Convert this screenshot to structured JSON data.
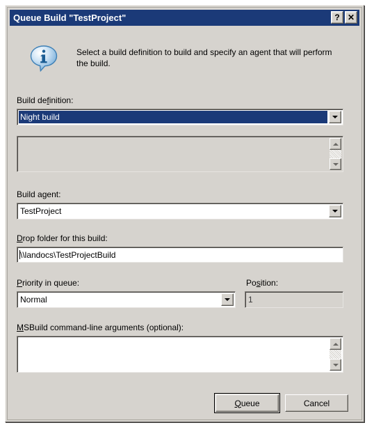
{
  "window": {
    "title": "Queue Build \"TestProject\"",
    "help_button": "?",
    "close_button": "✕",
    "titlebar_color": "#1b3a78",
    "face_color": "#d6d3ce"
  },
  "message": {
    "icon": "info-icon",
    "text": "Select a build definition to build and specify an agent that will perform the build."
  },
  "build_definition": {
    "label_pre": "Build de",
    "label_accel": "f",
    "label_post": "inition:",
    "value": "Night build"
  },
  "definition_details": {
    "value": ""
  },
  "build_agent": {
    "label_pre": "Build a",
    "label_accel": "g",
    "label_post": "ent:",
    "value": "TestProject"
  },
  "drop_folder": {
    "label_accel": "D",
    "label_post": "rop folder for this build:",
    "value": "\\\\landocs\\TestProjectBuild"
  },
  "priority": {
    "label_accel": "P",
    "label_post": "riority in queue:",
    "value": "Normal"
  },
  "position": {
    "label_pre": "Po",
    "label_accel": "s",
    "label_post": "ition:",
    "value": "1"
  },
  "msbuild_args": {
    "label_accel": "M",
    "label_post": "SBuild command-line arguments (optional):",
    "value": ""
  },
  "buttons": {
    "queue_accel": "Q",
    "queue_post": "ueue",
    "cancel": "Cancel"
  }
}
